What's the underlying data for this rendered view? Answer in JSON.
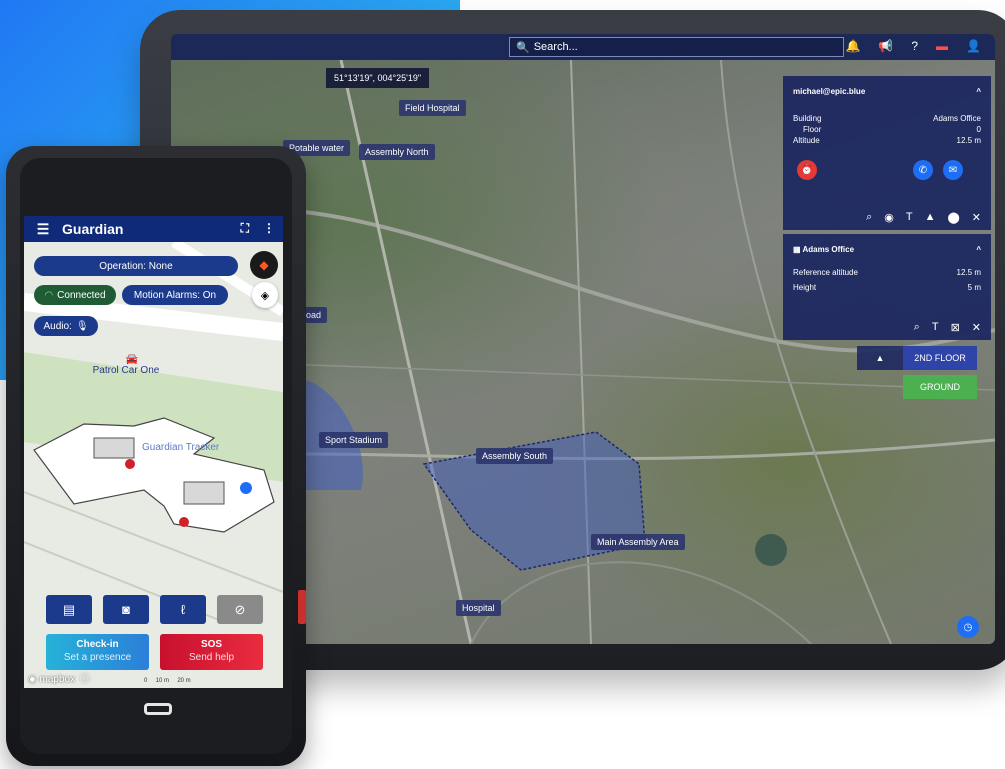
{
  "tablet": {
    "search": {
      "placeholder": "Search..."
    },
    "topbar_icons": [
      "bell-icon",
      "megaphone-icon",
      "help-icon",
      "flag-uk-icon",
      "user-icon"
    ],
    "coordinates": "51°13'19\", 004°25'19\"",
    "map_labels": {
      "field_hospital": "Field Hospital",
      "potable_water": "Potable water",
      "assembly_north": "Assembly North",
      "road": "road",
      "sport_stadium": "Sport Stadium",
      "assembly_south": "Assembly South",
      "main_assembly_area": "Main Assembly Area",
      "hospital": "Hospital"
    },
    "user_panel": {
      "email": "michael@epic.blue",
      "building_label": "Building",
      "building_value": "Adams Office",
      "floor_label": "Floor",
      "floor_value": "0",
      "altitude_label": "Altitude",
      "altitude_value": "12.5",
      "altitude_unit": "m",
      "chevron": "^"
    },
    "office_panel": {
      "title": "Adams Office",
      "ref_alt_label": "Reference altitude",
      "ref_alt_value": "12.5",
      "ref_alt_unit": "m",
      "height_label": "Height",
      "height_value": "5",
      "height_unit": "m",
      "chevron": "^"
    },
    "floors": {
      "upper": "2ND FLOOR",
      "ground": "GROUND",
      "up_arrow": "▲"
    },
    "colors": {
      "topbar": "#1c2858",
      "panel": "#1e2860",
      "floor_ground": "#4caf50",
      "floor_upper": "#2e44a8"
    }
  },
  "phone": {
    "app_title": "Guardian",
    "operation": "Operation: None",
    "connected": "Connected",
    "motion_alarms": "Motion Alarms: On",
    "audio": "Audio:",
    "map_label_patrol": "Patrol Car One",
    "map_label_tracker": "Guardian Tracker",
    "checkin_title": "Check-in",
    "checkin_sub": "Set a presence",
    "sos_title": "SOS",
    "sos_sub": "Send help",
    "mapbox": "mapbox",
    "scale": "0     10 m     20 m",
    "colors": {
      "header": "#0e2a78",
      "checkin": "#2aa6d8",
      "sos": "#e0203a",
      "pill": "#1c3a8c",
      "connected": "#1f5c35"
    }
  }
}
